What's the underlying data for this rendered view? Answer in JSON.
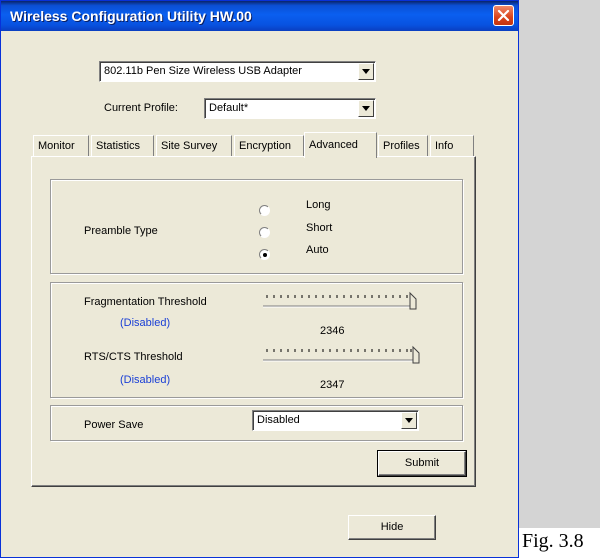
{
  "window": {
    "title": "Wireless Configuration Utility HW.00"
  },
  "adapter": {
    "selected": "802.11b Pen Size Wireless USB Adapter"
  },
  "profile": {
    "label": "Current Profile:",
    "selected": "Default*"
  },
  "tabs": [
    {
      "label": "Monitor"
    },
    {
      "label": "Statistics"
    },
    {
      "label": "Site Survey"
    },
    {
      "label": "Encryption"
    },
    {
      "label": "Advanced",
      "active": true
    },
    {
      "label": "Profiles"
    },
    {
      "label": "Info"
    }
  ],
  "preamble": {
    "label": "Preamble Type",
    "options": [
      "Long",
      "Short",
      "Auto"
    ],
    "selected": "Auto"
  },
  "fragmentation": {
    "label": "Fragmentation Threshold",
    "status": "(Disabled)",
    "value": "2346"
  },
  "rts": {
    "label": "RTS/CTS Threshold",
    "status": "(Disabled)",
    "value": "2347"
  },
  "power_save": {
    "label": "Power Save",
    "selected": "Disabled"
  },
  "buttons": {
    "submit": "Submit",
    "hide": "Hide"
  },
  "caption": "Fig. 3.8",
  "colors": {
    "titlebar": "#0a5ff0",
    "dialog_bg": "#ece9d8",
    "status_text": "#1a3fd6",
    "close_button": "#d9431b"
  }
}
